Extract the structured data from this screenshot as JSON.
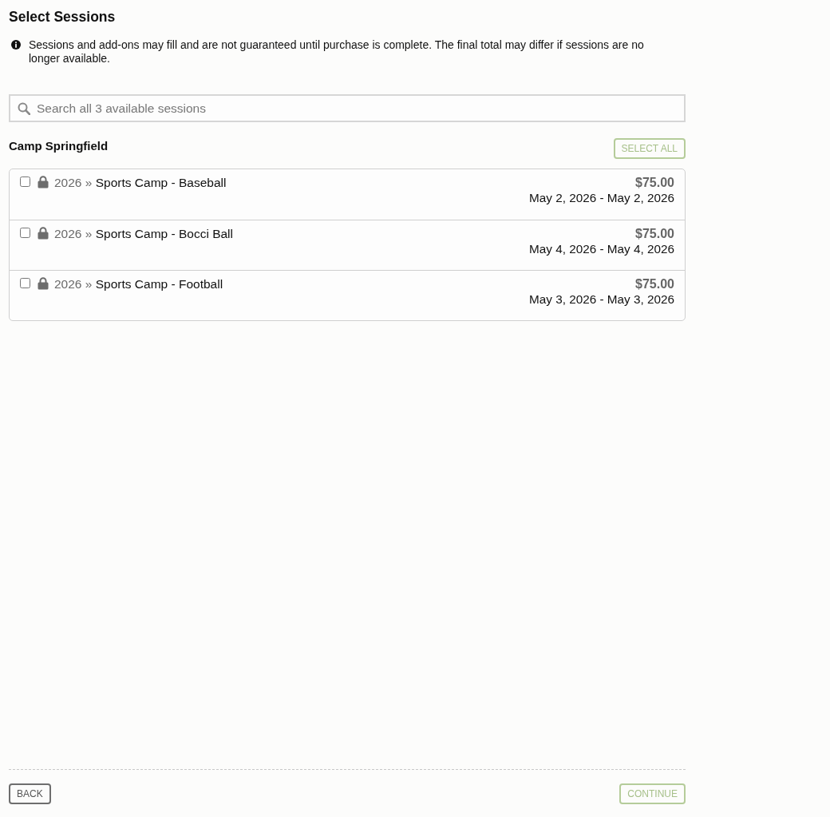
{
  "page": {
    "title": "Select Sessions"
  },
  "notice": {
    "text": "Sessions and add-ons may fill and are not guaranteed until purchase is complete. The final total may differ if sessions are no longer available."
  },
  "search": {
    "placeholder": "Search all 3 available sessions"
  },
  "group": {
    "title": "Camp Springfield",
    "select_all": "SELECT ALL"
  },
  "sessions": [
    {
      "year": "2026",
      "separator": "»",
      "name": "Sports Camp - Baseball",
      "price": "$75.00",
      "dates": "May 2, 2026 - May 2, 2026",
      "checked": false,
      "locked": true
    },
    {
      "year": "2026",
      "separator": "»",
      "name": "Sports Camp - Bocci Ball",
      "price": "$75.00",
      "dates": "May 4, 2026 - May 4, 2026",
      "checked": false,
      "locked": true
    },
    {
      "year": "2026",
      "separator": "»",
      "name": "Sports Camp - Football",
      "price": "$75.00",
      "dates": "May 3, 2026 - May 3, 2026",
      "checked": false,
      "locked": true
    }
  ],
  "footer": {
    "back": {
      "label": "BACK",
      "disabled": false
    },
    "continue": {
      "label": "CONTINUE",
      "disabled": true
    }
  }
}
